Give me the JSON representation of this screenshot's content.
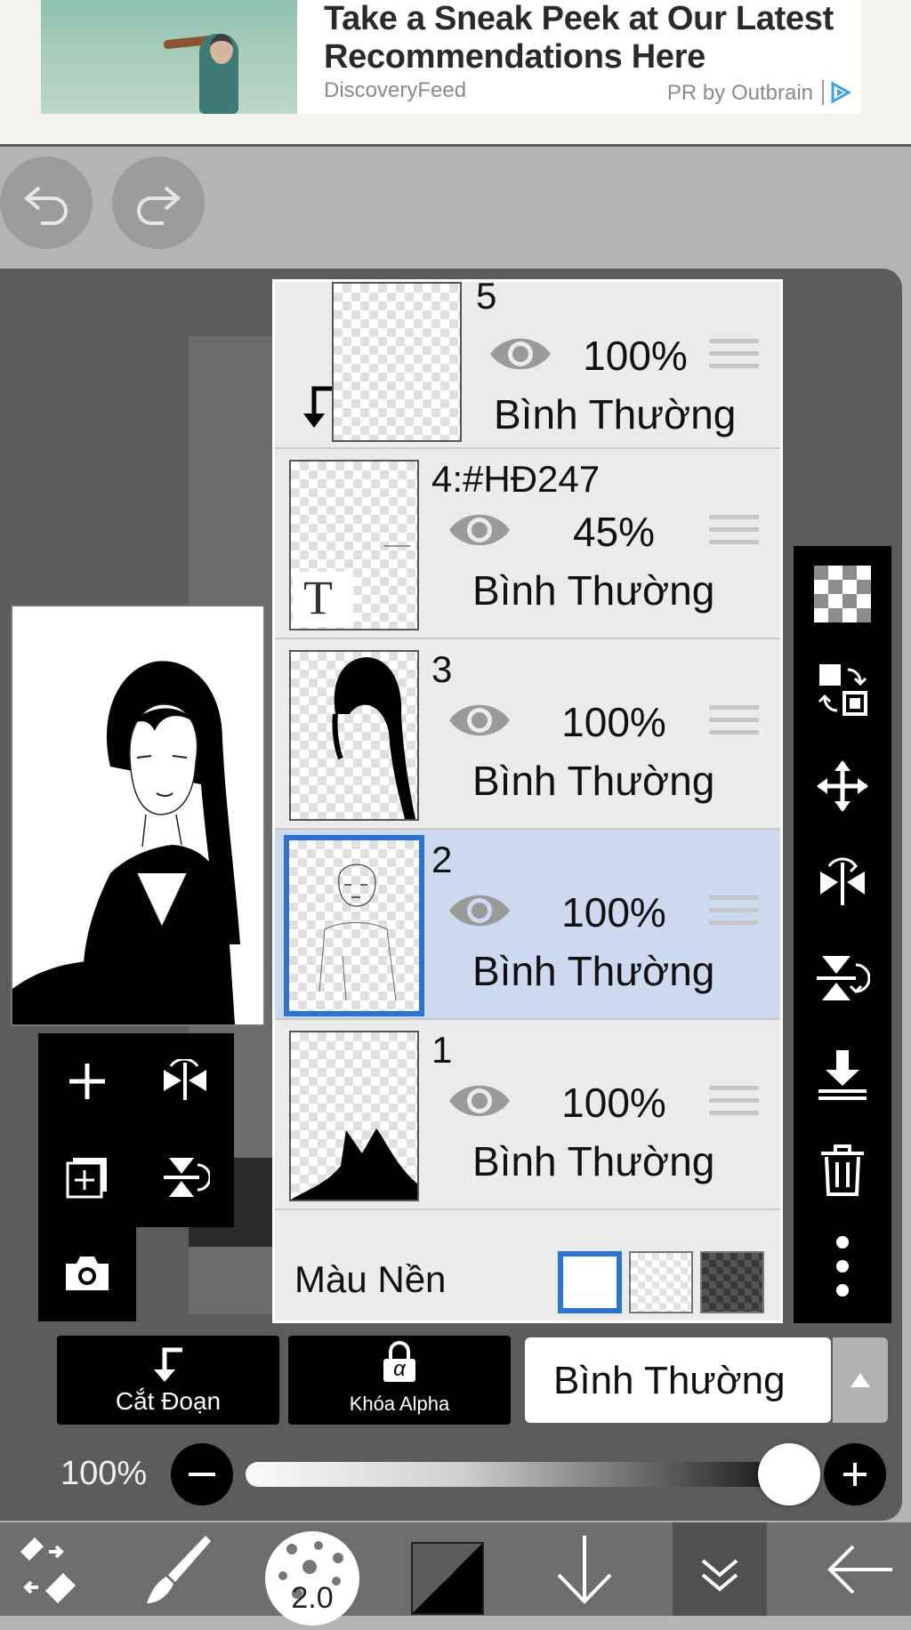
{
  "ad": {
    "title": "Take a Sneak Peek at Our Latest Recommendations Here",
    "source": "DiscoveryFeed",
    "sponsor": "PR by Outbrain",
    "adchoices_icon": "adchoices-icon"
  },
  "history": {
    "undo_icon": "undo-icon",
    "redo_icon": "redo-icon"
  },
  "layers": [
    {
      "name": "5",
      "opacity": "100%",
      "blend": "Bình Thường",
      "clipped": true
    },
    {
      "name": "4:#HĐ247",
      "opacity": "45%",
      "blend": "Bình Thường",
      "text_layer_glyph": "T"
    },
    {
      "name": "3",
      "opacity": "100%",
      "blend": "Bình Thường"
    },
    {
      "name": "2",
      "opacity": "100%",
      "blend": "Bình Thường",
      "selected": true
    },
    {
      "name": "1",
      "opacity": "100%",
      "blend": "Bình Thường"
    }
  ],
  "background": {
    "label": "Màu Nền",
    "options": [
      "white",
      "transparent",
      "dark-checker"
    ],
    "selected": "white"
  },
  "left_tools": [
    "add-layer-icon",
    "flip-horizontal-icon",
    "add-special-layer-icon",
    "flip-vertical-icon",
    "camera-icon"
  ],
  "right_tools": [
    "transparency-icon",
    "layer-swap-icon",
    "move-icon",
    "flip-h-icon",
    "flip-v-icon",
    "merge-down-icon",
    "trash-icon",
    "more-icon"
  ],
  "controls": {
    "clip_label": "Cắt Đoạn",
    "alpha_lock_label": "Khóa Alpha",
    "alpha_glyph": "α",
    "blend_mode": "Bình Thường"
  },
  "opacity": {
    "label": "100%",
    "value": 1.0
  },
  "toolbar": {
    "brush_size": "2.0",
    "items": [
      "transform-icon",
      "brush-icon",
      "brush-size",
      "color-swatch",
      "down-arrow-icon",
      "double-chevron-icon",
      "back-icon"
    ]
  },
  "colors": {
    "accent": "#2b74d6",
    "selected_row": "#ccd9ee"
  }
}
